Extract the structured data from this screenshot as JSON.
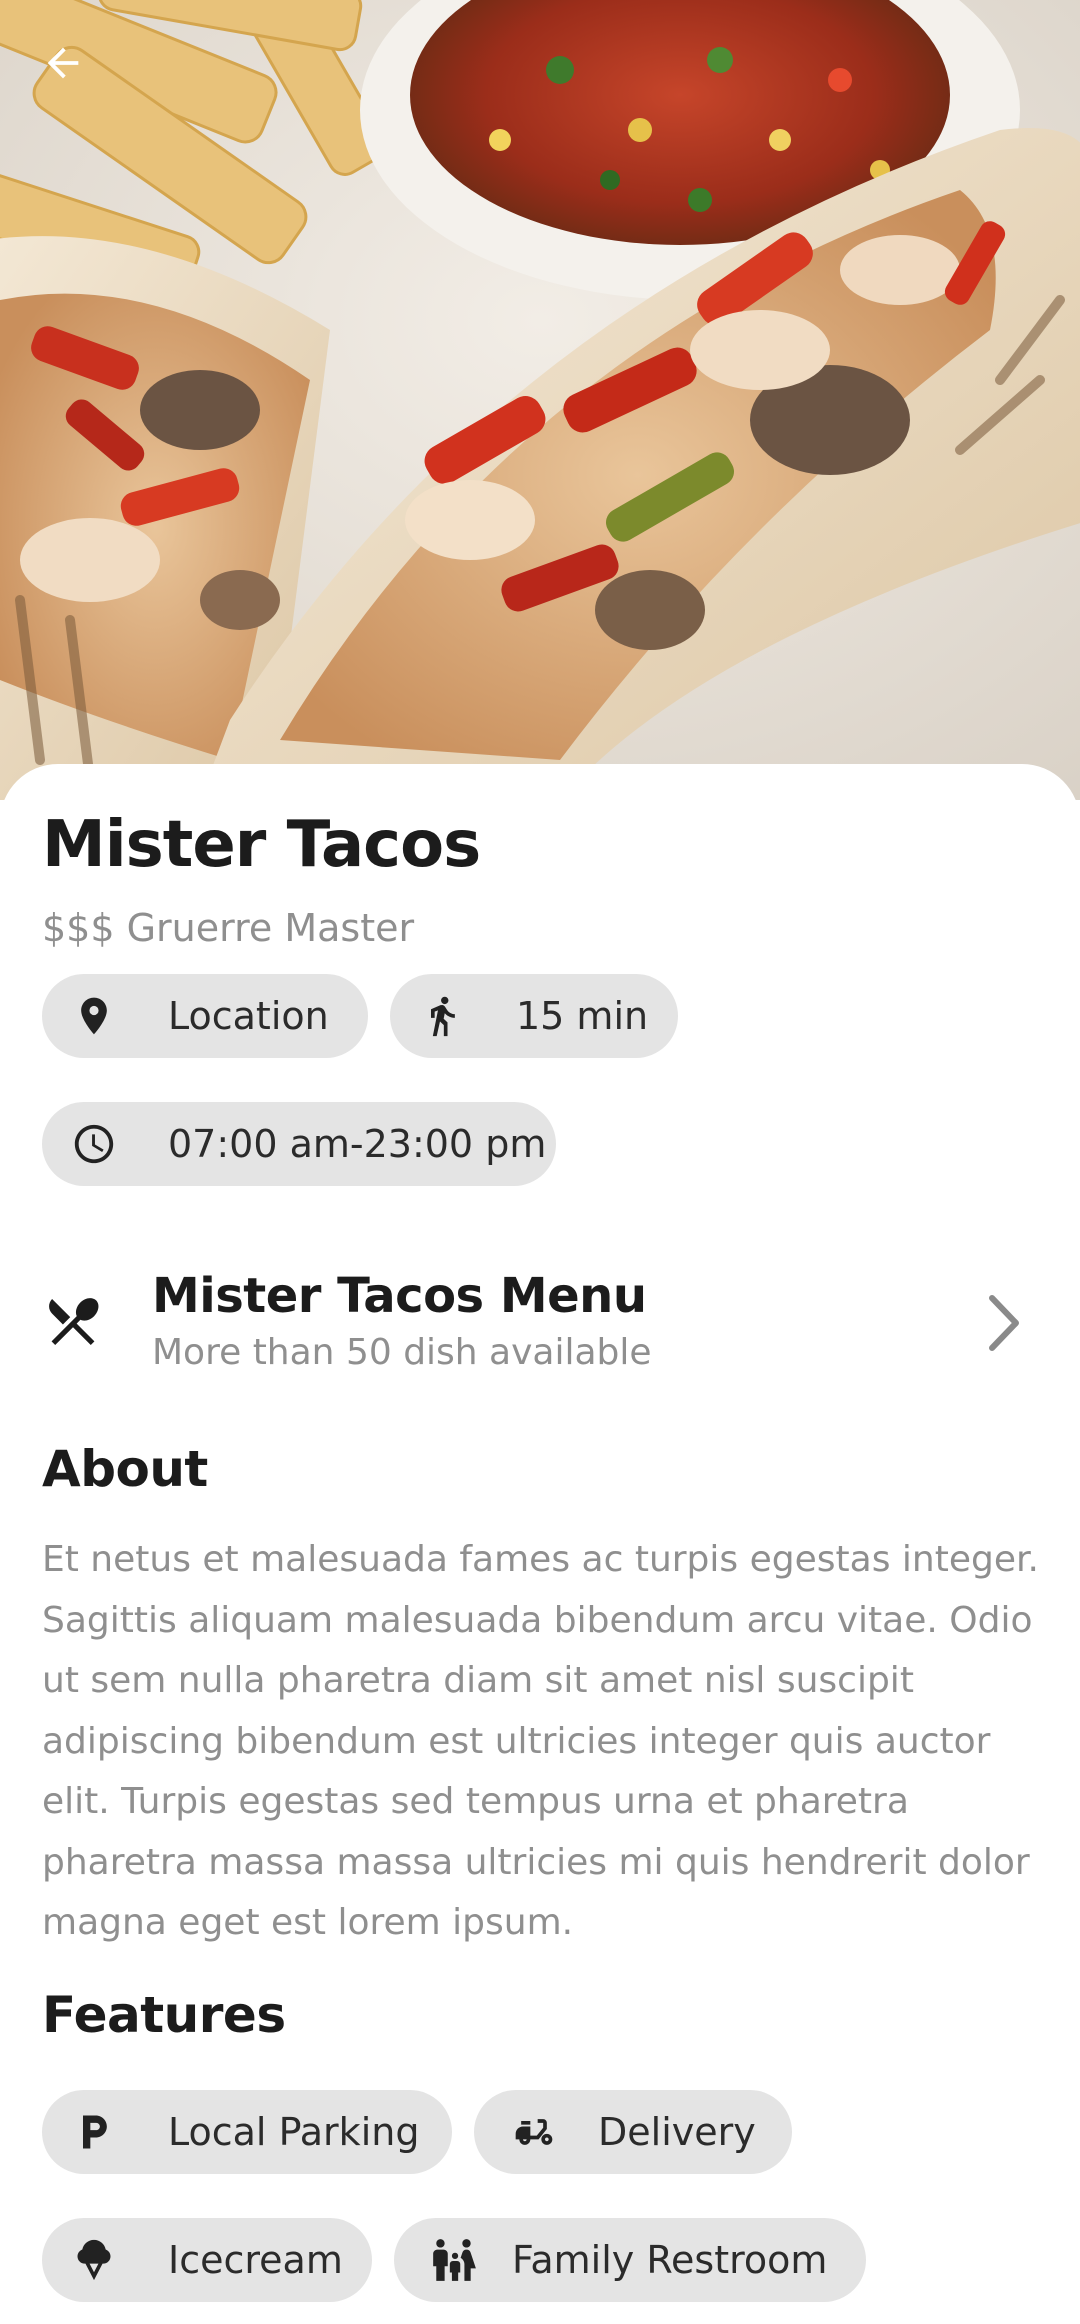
{
  "header": {
    "back_icon": "arrow-left-icon"
  },
  "restaurant": {
    "name": "Mister Tacos",
    "subtitle": "$$$ Gruerre Master"
  },
  "info_chips": [
    {
      "icon": "location-pin-icon",
      "label": "Location"
    },
    {
      "icon": "walking-person-icon",
      "label": "15 min"
    },
    {
      "icon": "clock-icon",
      "label": "07:00 am-23:00 pm"
    }
  ],
  "menu": {
    "icon": "fork-knife-icon",
    "title": "Mister Tacos Menu",
    "subtitle": "More than 50 dish available",
    "chevron_icon": "chevron-right-icon"
  },
  "about": {
    "heading": "About",
    "text": "Et netus et malesuada fames ac turpis egestas integer. Sagittis aliquam malesuada bibendum arcu vitae. Odio ut sem nulla pharetra diam sit amet nisl suscipit adipiscing bibendum est ultricies integer quis auctor elit. Turpis egestas sed tempus urna et pharetra pharetra massa massa ultricies mi quis hendrerit dolor magna eget est lorem ipsum."
  },
  "features": {
    "heading": "Features",
    "items": [
      {
        "icon": "parking-icon",
        "label": "Local Parking"
      },
      {
        "icon": "scooter-delivery-icon",
        "label": "Delivery"
      },
      {
        "icon": "icecream-icon",
        "label": "Icecream"
      },
      {
        "icon": "family-icon",
        "label": "Family Restroom"
      }
    ]
  },
  "colors": {
    "chip_background": "#e4e4e4",
    "secondary_text": "#8f8f8f",
    "primary_text": "#1c1c1c"
  }
}
